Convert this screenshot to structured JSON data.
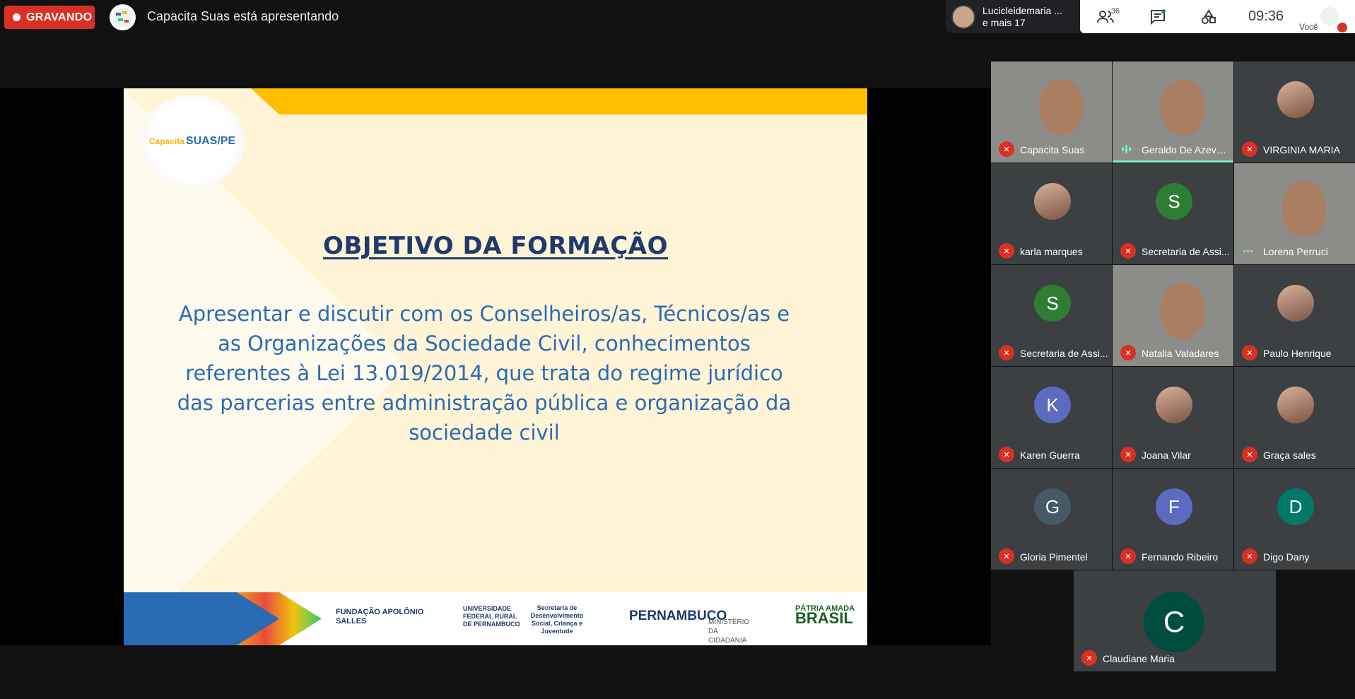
{
  "topbar": {
    "recording_label": "GRAVANDO",
    "presenting_text": "Capacita Suas está apresentando",
    "viewers_name": "Lucicleidemaria ...",
    "viewers_more": "e mais 17",
    "participants_count": "36",
    "time": "09:36",
    "you_label": "Você"
  },
  "slide": {
    "logo_text_prefix": "Capacita",
    "logo_text": "SUAS/PE",
    "title": "OBJETIVO DA FORMAÇÃO",
    "body": "Apresentar e discutir com os Conselheiros/as, Técnicos/as e as Organizações da Sociedade Civil, conhecimentos referentes à Lei 13.019/2014, que trata do regime jurídico das parcerias entre administração pública e organização da sociedade civil",
    "footer": {
      "fundacao": "FUNDAÇÃO APOLÔNIO SALLES",
      "ufrpe": "UNIVERSIDADE FEDERAL RURAL DE PERNAMBUCO",
      "secretaria": "Secretaria de Desenvolvimento Social, Criança e Juventude",
      "pernambuco": "PERNAMBUCO",
      "ministerio": "MINISTÉRIO DA CIDADANIA",
      "patria": "PÁTRIA AMADA",
      "brasil": "BRASIL"
    }
  },
  "participants": [
    {
      "name": "Capacita Suas",
      "kind": "video",
      "muted": true
    },
    {
      "name": "Geraldo De Azeve...",
      "kind": "video",
      "speaking": true
    },
    {
      "name": "VIRGINIA MARIA",
      "kind": "photo",
      "muted": true
    },
    {
      "name": "karla marques",
      "kind": "photo",
      "muted": true
    },
    {
      "name": "Secretaria de Assi...",
      "kind": "letter",
      "letter": "S",
      "color": "#2e7d32",
      "muted": true
    },
    {
      "name": "Lorena Perruci",
      "kind": "video",
      "dots": true
    },
    {
      "name": "Secretaria de Assi...",
      "kind": "letter",
      "letter": "S",
      "color": "#2e7d32",
      "muted": true
    },
    {
      "name": "Natalia Valadares",
      "kind": "video",
      "muted": true
    },
    {
      "name": "Paulo Henrique",
      "kind": "photo",
      "muted": true
    },
    {
      "name": "Karen Guerra",
      "kind": "letter",
      "letter": "K",
      "color": "#5c6bc0",
      "muted": true
    },
    {
      "name": "Joana Vilar",
      "kind": "photo",
      "muted": true
    },
    {
      "name": "Graça sales",
      "kind": "photo",
      "muted": true
    },
    {
      "name": "Gloria Pimentel",
      "kind": "letter",
      "letter": "G",
      "color": "#455a64",
      "muted": true
    },
    {
      "name": "Fernando Ribeiro",
      "kind": "letter",
      "letter": "F",
      "color": "#5c6bc0",
      "muted": true
    },
    {
      "name": "Digo Dany",
      "kind": "letter",
      "letter": "D",
      "color": "#00796b",
      "muted": true
    },
    {
      "name": "Claudiane Maria",
      "kind": "letter",
      "letter": "C",
      "color": "#004d40",
      "muted": true
    }
  ],
  "colors": {
    "recording": "#d93025",
    "speaking": "#78f1c1",
    "slide_title": "#1f3a6e",
    "slide_body": "#2a6bb5",
    "slide_gold": "#ffbe00"
  }
}
